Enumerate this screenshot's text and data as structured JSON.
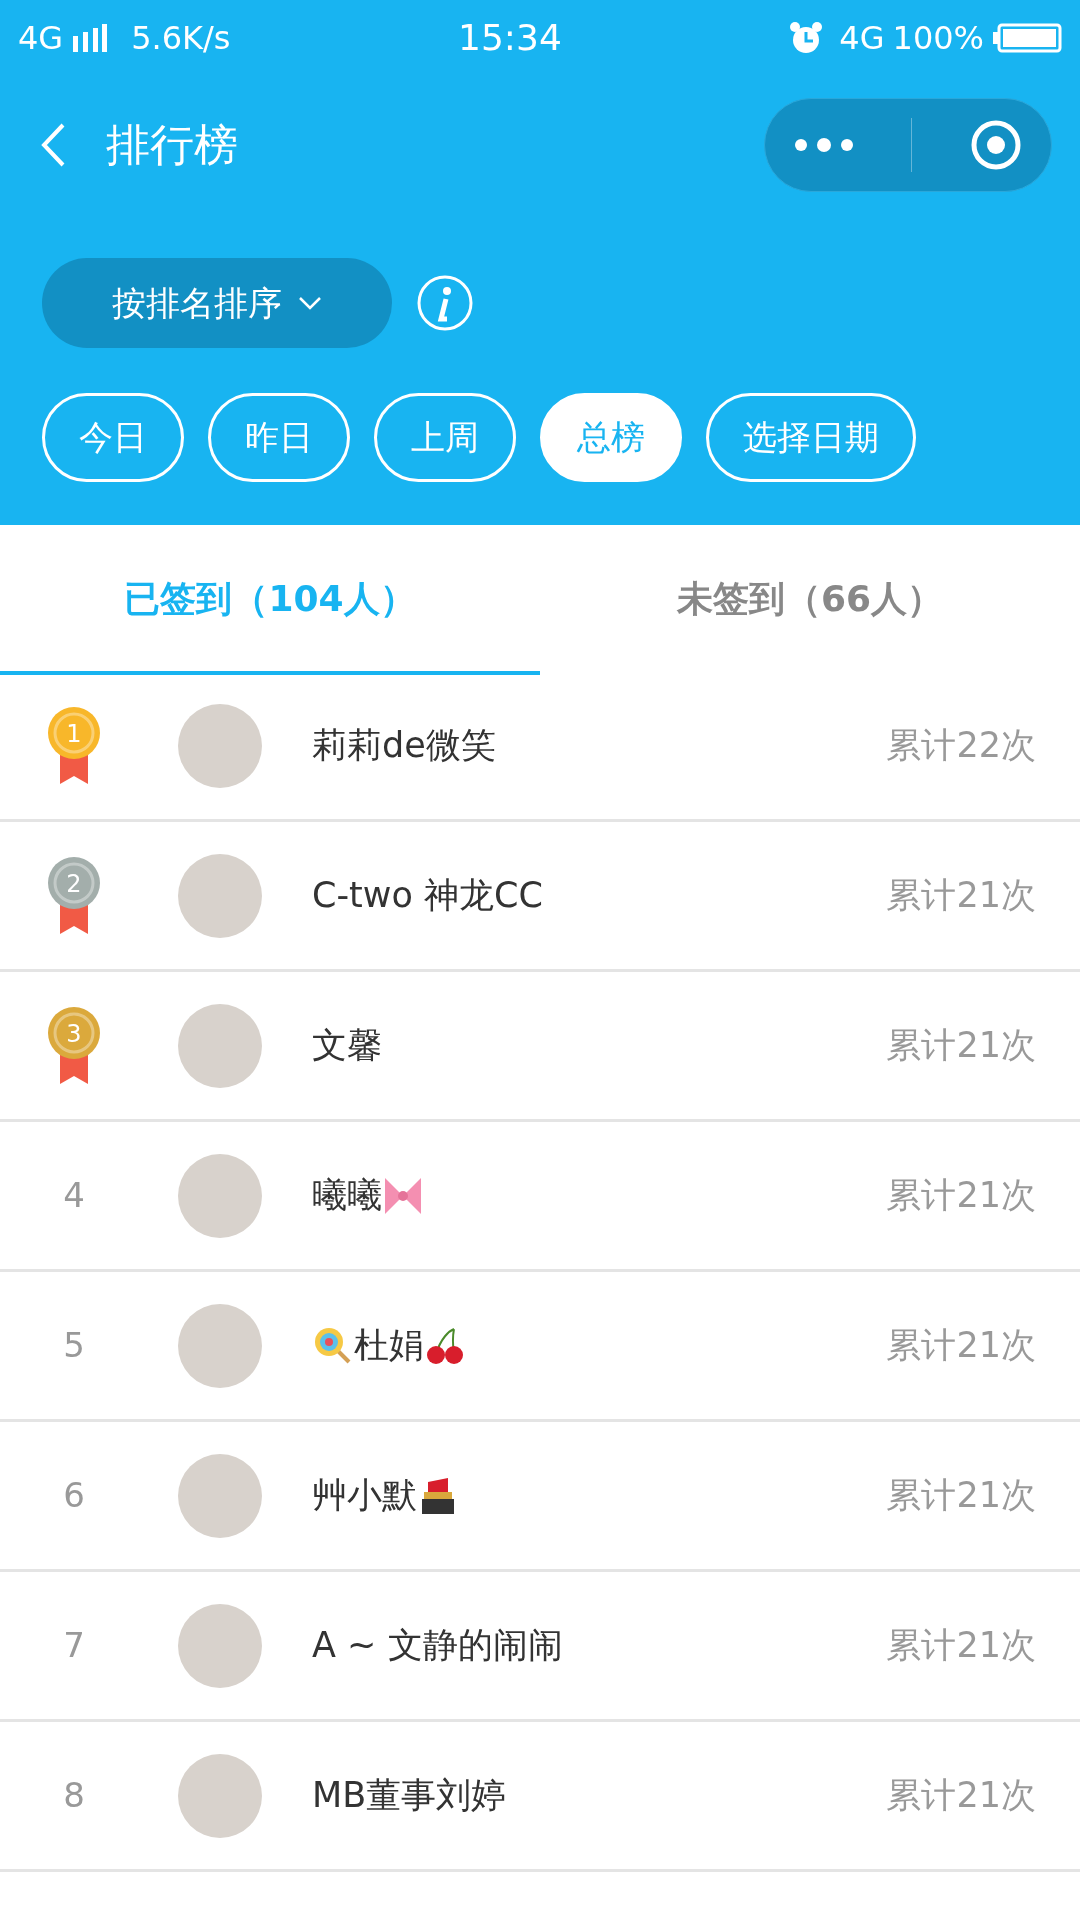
{
  "status_bar": {
    "network": "4G",
    "speed": "5.6K/s",
    "time": "15:34",
    "network_right": "4G",
    "battery": "100%"
  },
  "header": {
    "title": "排行榜"
  },
  "sort_button": {
    "label": "按排名排序"
  },
  "filters": [
    {
      "label": "今日",
      "selected": false
    },
    {
      "label": "昨日",
      "selected": false
    },
    {
      "label": "上周",
      "selected": false
    },
    {
      "label": "总榜",
      "selected": true
    },
    {
      "label": "选择日期",
      "selected": false
    }
  ],
  "tabs": [
    {
      "label": "已签到（104人）",
      "selected": true
    },
    {
      "label": "未签到（66人）",
      "selected": false
    }
  ],
  "rows": [
    {
      "rank": "1",
      "kind": "medal",
      "color": "#f8b72a",
      "name": "莉莉de微笑",
      "count": "累计22次"
    },
    {
      "rank": "2",
      "kind": "medal",
      "color": "#a3aeab",
      "name": "C-two 神龙CC",
      "count": "累计21次"
    },
    {
      "rank": "3",
      "kind": "medal",
      "color": "#dba93c",
      "name": "文馨",
      "count": "累计21次"
    },
    {
      "rank": "4",
      "kind": "number",
      "name": "曦曦",
      "icons_after": [
        {
          "kind": "bow"
        }
      ],
      "count": "累计21次"
    },
    {
      "rank": "5",
      "kind": "number",
      "icons_before": [
        {
          "kind": "lollipop"
        }
      ],
      "name": "杜娟",
      "icons_after": [
        {
          "kind": "cherry"
        }
      ],
      "count": "累计21次"
    },
    {
      "rank": "6",
      "kind": "number",
      "name": "艸小默",
      "icons_after": [
        {
          "kind": "lipstick"
        }
      ],
      "count": "累计21次"
    },
    {
      "rank": "7",
      "kind": "number",
      "name": "A ~ 文静的闹闹",
      "count": "累计21次"
    },
    {
      "rank": "8",
      "kind": "number",
      "name": "MB董事刘婷",
      "count": "累计21次"
    }
  ]
}
